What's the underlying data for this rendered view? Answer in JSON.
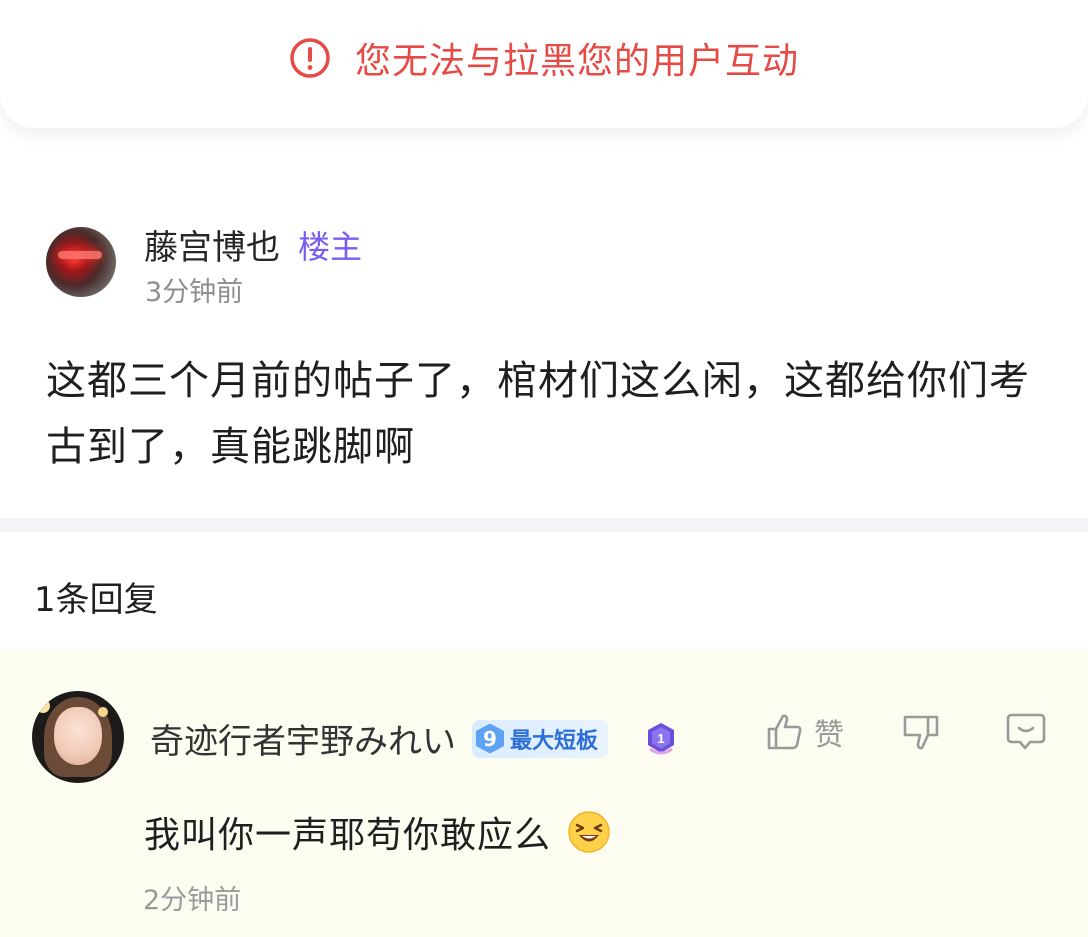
{
  "banner": {
    "text": "您无法与拉黑您的用户互动",
    "icon": "exclamation-circle-icon",
    "color": "#e54a45"
  },
  "post": {
    "author": "藤宫博也",
    "op_tag": "楼主",
    "time": "3分钟前",
    "content": "这都三个月前的帖子了，棺材们这么闲，这都给你们考古到了，真能跳脚啊"
  },
  "replies": {
    "count_label": "1条回复",
    "items": [
      {
        "author": "奇迹行者宇野みれい",
        "level": "9",
        "level_title": "最大短板",
        "medal_icon": "rank-medal-icon",
        "like_label": "赞",
        "content": "我叫你一声耶苟你敢应么",
        "emoji": "laughing-emoji",
        "time": "2分钟前"
      }
    ]
  },
  "colors": {
    "accent_purple": "#7a5cf0",
    "reply_bg": "#fdfcf1",
    "muted_text": "#8e8e93"
  }
}
